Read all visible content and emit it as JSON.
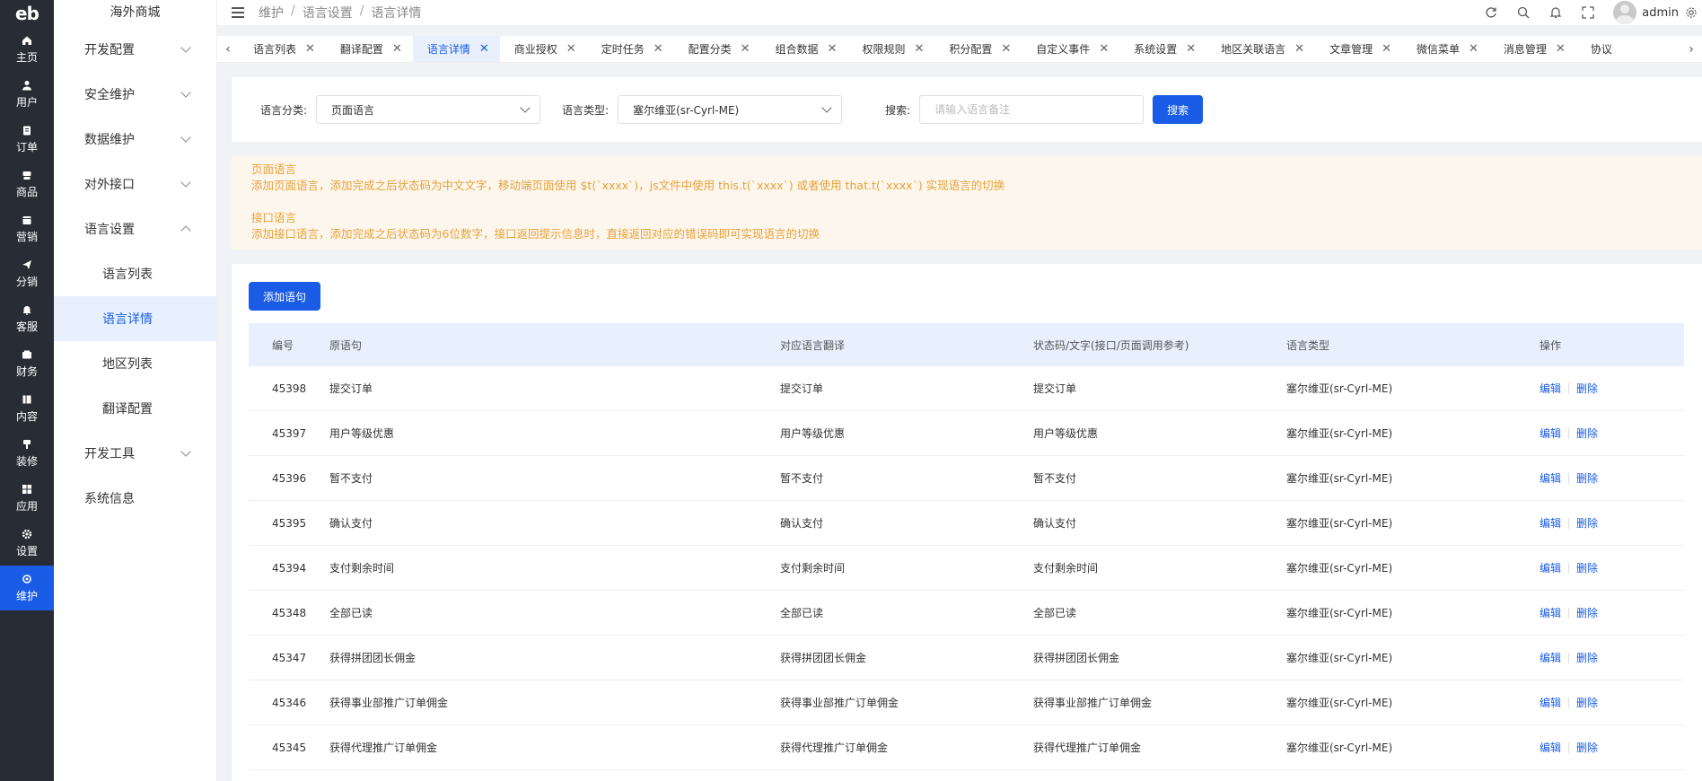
{
  "logo_text": "eb",
  "iconbar": [
    {
      "label": "主页",
      "icon": "home-icon"
    },
    {
      "label": "用户",
      "icon": "user-icon"
    },
    {
      "label": "订单",
      "icon": "clipboard-icon"
    },
    {
      "label": "商品",
      "icon": "shop-icon"
    },
    {
      "label": "营销",
      "icon": "calendar-icon"
    },
    {
      "label": "分销",
      "icon": "send-icon"
    },
    {
      "label": "客服",
      "icon": "bell-icon"
    },
    {
      "label": "财务",
      "icon": "wallet-icon"
    },
    {
      "label": "内容",
      "icon": "book-icon"
    },
    {
      "label": "装修",
      "icon": "brush-icon"
    },
    {
      "label": "应用",
      "icon": "grid-icon"
    },
    {
      "label": "设置",
      "icon": "gear-icon"
    },
    {
      "label": "维护",
      "icon": "maintenance-icon",
      "active": true
    }
  ],
  "sidebar": {
    "title": "海外商城",
    "items": [
      {
        "label": "开发配置"
      },
      {
        "label": "安全维护"
      },
      {
        "label": "数据维护"
      },
      {
        "label": "对外接口"
      },
      {
        "label": "语言设置"
      },
      {
        "label": "语言列表"
      },
      {
        "label": "语言详情"
      },
      {
        "label": "地区列表"
      },
      {
        "label": "翻译配置"
      },
      {
        "label": "开发工具"
      },
      {
        "label": "系统信息"
      }
    ]
  },
  "breadcrumb": [
    "维护",
    "语言设置",
    "语言详情"
  ],
  "breadcrumb_sep": "/",
  "user": {
    "name": "admin"
  },
  "tabs": [
    {
      "label": "语言列表"
    },
    {
      "label": "翻译配置"
    },
    {
      "label": "语言详情"
    },
    {
      "label": "商业授权"
    },
    {
      "label": "定时任务"
    },
    {
      "label": "配置分类"
    },
    {
      "label": "组合数据"
    },
    {
      "label": "权限规则"
    },
    {
      "label": "积分配置"
    },
    {
      "label": "自定义事件"
    },
    {
      "label": "系统设置"
    },
    {
      "label": "地区关联语言"
    },
    {
      "label": "文章管理"
    },
    {
      "label": "微信菜单"
    },
    {
      "label": "消息管理"
    },
    {
      "label": "协议"
    }
  ],
  "filter": {
    "category_label": "语言分类:",
    "category_value": "页面语言",
    "type_label": "语言类型:",
    "type_value": "塞尔维亚(sr-Cyrl-ME)",
    "search_label": "搜索:",
    "search_placeholder": "请输入语言备注",
    "search_button": "搜索"
  },
  "notice": {
    "line1": "页面语言",
    "line2": "添加页面语言，添加完成之后状态码为中文文字，移动端页面使用 $t(`xxxx`)，js文件中使用 this.t(`xxxx`) 或者使用 that.t(`xxxx`) 实现语言的切换",
    "line3": "接口语言",
    "line4": "添加接口语言，添加完成之后状态码为6位数字，接口返回提示信息时，直接返回对应的错误码即可实现语言的切换"
  },
  "table": {
    "add_button": "添加语句",
    "headers": [
      "编号",
      "原语句",
      "对应语言翻译",
      "状态码/文字(接口/页面调用参考)",
      "语言类型",
      "操作"
    ],
    "edit_label": "编辑",
    "delete_label": "删除",
    "rows": [
      {
        "id": "45398",
        "src": "提交订单",
        "trans": "提交订单",
        "code": "提交订单",
        "lang": "塞尔维亚(sr-Cyrl-ME)"
      },
      {
        "id": "45397",
        "src": "用户等级优惠",
        "trans": "用户等级优惠",
        "code": "用户等级优惠",
        "lang": "塞尔维亚(sr-Cyrl-ME)"
      },
      {
        "id": "45396",
        "src": "暂不支付",
        "trans": "暂不支付",
        "code": "暂不支付",
        "lang": "塞尔维亚(sr-Cyrl-ME)"
      },
      {
        "id": "45395",
        "src": "确认支付",
        "trans": "确认支付",
        "code": "确认支付",
        "lang": "塞尔维亚(sr-Cyrl-ME)"
      },
      {
        "id": "45394",
        "src": "支付剩余时间",
        "trans": "支付剩余时间",
        "code": "支付剩余时间",
        "lang": "塞尔维亚(sr-Cyrl-ME)"
      },
      {
        "id": "45348",
        "src": "全部已读",
        "trans": "全部已读",
        "code": "全部已读",
        "lang": "塞尔维亚(sr-Cyrl-ME)"
      },
      {
        "id": "45347",
        "src": "获得拼团团长佣金",
        "trans": "获得拼团团长佣金",
        "code": "获得拼团团长佣金",
        "lang": "塞尔维亚(sr-Cyrl-ME)"
      },
      {
        "id": "45346",
        "src": "获得事业部推广订单佣金",
        "trans": "获得事业部推广订单佣金",
        "code": "获得事业部推广订单佣金",
        "lang": "塞尔维亚(sr-Cyrl-ME)"
      },
      {
        "id": "45345",
        "src": "获得代理推广订单佣金",
        "trans": "获得代理推广订单佣金",
        "code": "获得代理推广订单佣金",
        "lang": "塞尔维亚(sr-Cyrl-ME)"
      }
    ]
  },
  "colors": {
    "primary": "#1a5ce5",
    "sidebar_dark": "#282c34",
    "notice_text": "#e6a23c",
    "notice_bg": "#fdf6ec"
  }
}
